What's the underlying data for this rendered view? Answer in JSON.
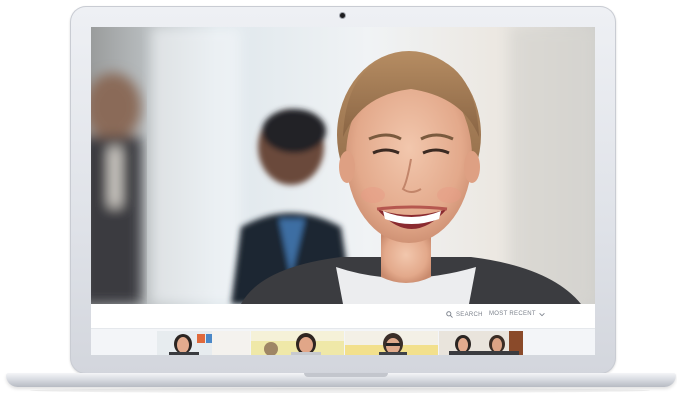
{
  "toolbar": {
    "search_label": "SEARCH",
    "search_icon": "search-icon",
    "sort_label": "MOST RECENT",
    "sort_icon": "chevron-down-icon"
  },
  "colors": {
    "laptop_silver": "#dfe2e8",
    "toolbar_text": "#7c828c",
    "screen_bg": "#f3f5f8"
  },
  "thumbnails": [
    {
      "kind": "video-thumbnail"
    },
    {
      "kind": "video-thumbnail"
    },
    {
      "kind": "video-thumbnail"
    },
    {
      "kind": "video-thumbnail"
    }
  ]
}
